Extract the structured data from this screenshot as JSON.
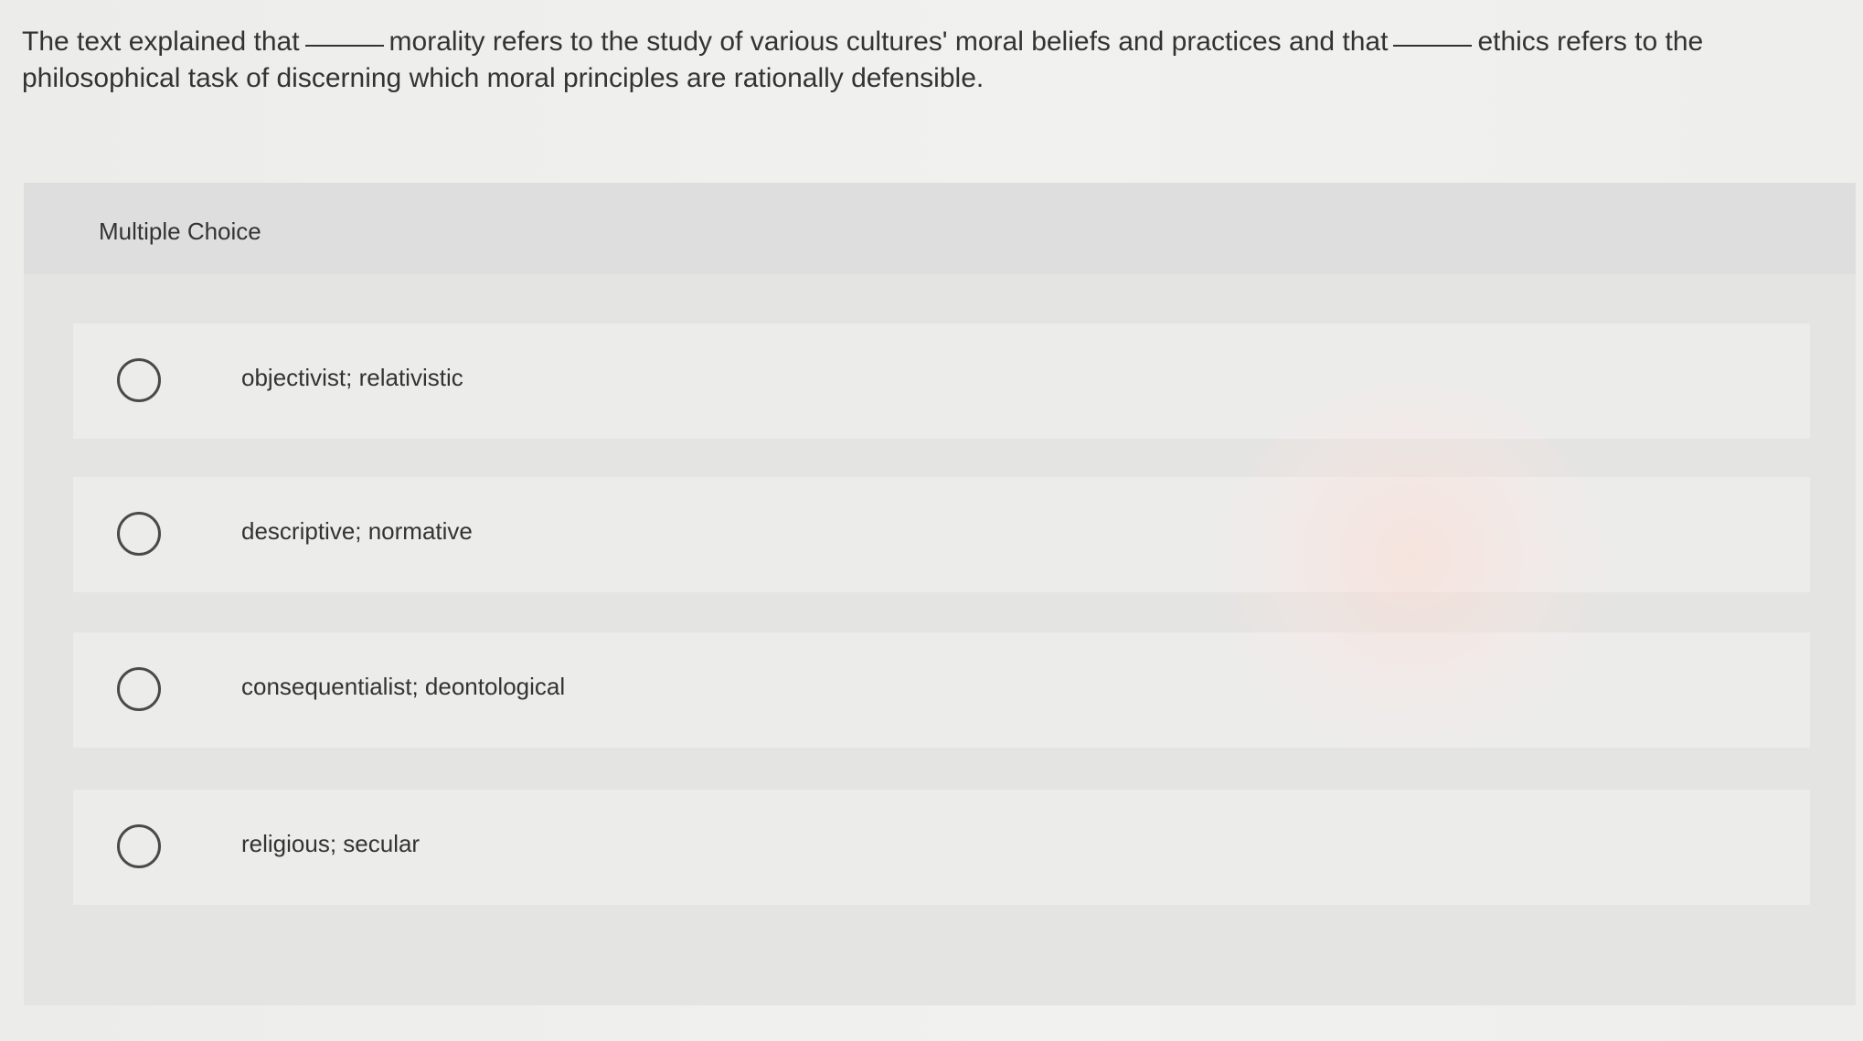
{
  "question": {
    "part1": "The text explained that",
    "part2": "morality refers to the study of various cultures' moral beliefs and practices and that",
    "part3": "ethics refers to the philosophical task of discerning which moral principles are rationally defensible."
  },
  "section": {
    "title": "Multiple Choice"
  },
  "options": [
    {
      "label": "objectivist; relativistic"
    },
    {
      "label": "descriptive; normative"
    },
    {
      "label": "consequentialist; deontological"
    },
    {
      "label": "religious; secular"
    }
  ]
}
